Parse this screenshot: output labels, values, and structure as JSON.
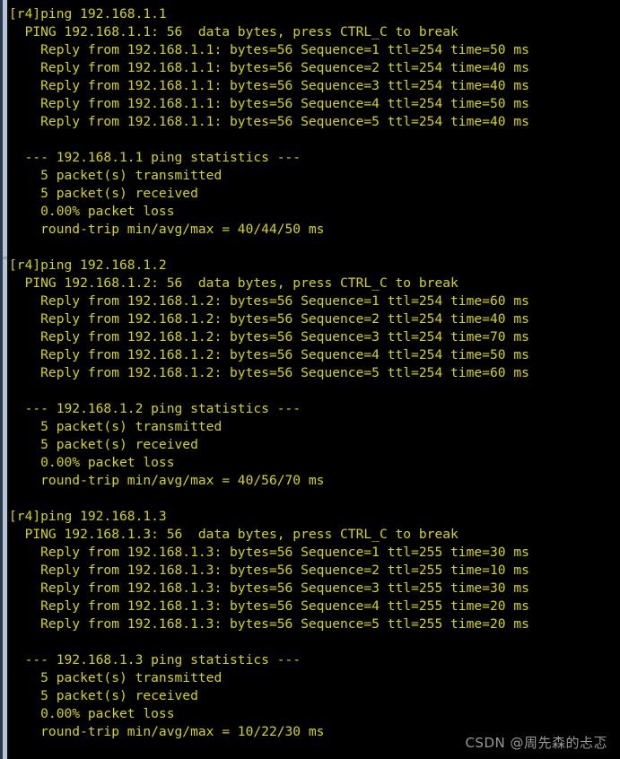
{
  "window": {
    "title": "Terminal - ping output",
    "background_color": "#000000",
    "text_color": "#d6d600",
    "chrome_edge_color": "#2b3b4d",
    "scrollbar_color": "#b6c5d8"
  },
  "watermark": {
    "text": "CSDN @周先森的忐忑",
    "color": "#9a9a9a"
  },
  "terminal": {
    "prompt": "[r4]",
    "lines": [
      "[r4]ping 192.168.1.1",
      "  PING 192.168.1.1: 56  data bytes, press CTRL_C to break",
      "    Reply from 192.168.1.1: bytes=56 Sequence=1 ttl=254 time=50 ms",
      "    Reply from 192.168.1.1: bytes=56 Sequence=2 ttl=254 time=40 ms",
      "    Reply from 192.168.1.1: bytes=56 Sequence=3 ttl=254 time=40 ms",
      "    Reply from 192.168.1.1: bytes=56 Sequence=4 ttl=254 time=50 ms",
      "    Reply from 192.168.1.1: bytes=56 Sequence=5 ttl=254 time=40 ms",
      "",
      "  --- 192.168.1.1 ping statistics ---",
      "    5 packet(s) transmitted",
      "    5 packet(s) received",
      "    0.00% packet loss",
      "    round-trip min/avg/max = 40/44/50 ms",
      "",
      "[r4]ping 192.168.1.2",
      "  PING 192.168.1.2: 56  data bytes, press CTRL_C to break",
      "    Reply from 192.168.1.2: bytes=56 Sequence=1 ttl=254 time=60 ms",
      "    Reply from 192.168.1.2: bytes=56 Sequence=2 ttl=254 time=40 ms",
      "    Reply from 192.168.1.2: bytes=56 Sequence=3 ttl=254 time=70 ms",
      "    Reply from 192.168.1.2: bytes=56 Sequence=4 ttl=254 time=50 ms",
      "    Reply from 192.168.1.2: bytes=56 Sequence=5 ttl=254 time=60 ms",
      "",
      "  --- 192.168.1.2 ping statistics ---",
      "    5 packet(s) transmitted",
      "    5 packet(s) received",
      "    0.00% packet loss",
      "    round-trip min/avg/max = 40/56/70 ms",
      "",
      "[r4]ping 192.168.1.3",
      "  PING 192.168.1.3: 56  data bytes, press CTRL_C to break",
      "    Reply from 192.168.1.3: bytes=56 Sequence=1 ttl=255 time=30 ms",
      "    Reply from 192.168.1.3: bytes=56 Sequence=2 ttl=255 time=10 ms",
      "    Reply from 192.168.1.3: bytes=56 Sequence=3 ttl=255 time=30 ms",
      "    Reply from 192.168.1.3: bytes=56 Sequence=4 ttl=255 time=20 ms",
      "    Reply from 192.168.1.3: bytes=56 Sequence=5 ttl=255 time=20 ms",
      "",
      "  --- 192.168.1.3 ping statistics ---",
      "    5 packet(s) transmitted",
      "    5 packet(s) received",
      "    0.00% packet loss",
      "    round-trip min/avg/max = 10/22/30 ms"
    ],
    "sessions": [
      {
        "command": "ping 192.168.1.1",
        "target": "192.168.1.1",
        "data_bytes": "56",
        "header": "PING 192.168.1.1: 56  data bytes, press CTRL_C to break",
        "replies": [
          {
            "sequence": "1",
            "bytes": "56",
            "ttl": "254",
            "time_ms": "50"
          },
          {
            "sequence": "2",
            "bytes": "56",
            "ttl": "254",
            "time_ms": "40"
          },
          {
            "sequence": "3",
            "bytes": "56",
            "ttl": "254",
            "time_ms": "40"
          },
          {
            "sequence": "4",
            "bytes": "56",
            "ttl": "254",
            "time_ms": "50"
          },
          {
            "sequence": "5",
            "bytes": "56",
            "ttl": "254",
            "time_ms": "40"
          }
        ],
        "statistics": {
          "header": "--- 192.168.1.1 ping statistics ---",
          "transmitted": "5 packet(s) transmitted",
          "received": "5 packet(s) received",
          "loss": "0.00% packet loss",
          "round_trip": "round-trip min/avg/max = 40/44/50 ms",
          "min_ms": "40",
          "avg_ms": "44",
          "max_ms": "50"
        }
      },
      {
        "command": "ping 192.168.1.2",
        "target": "192.168.1.2",
        "data_bytes": "56",
        "header": "PING 192.168.1.2: 56  data bytes, press CTRL_C to break",
        "replies": [
          {
            "sequence": "1",
            "bytes": "56",
            "ttl": "254",
            "time_ms": "60"
          },
          {
            "sequence": "2",
            "bytes": "56",
            "ttl": "254",
            "time_ms": "40"
          },
          {
            "sequence": "3",
            "bytes": "56",
            "ttl": "254",
            "time_ms": "70"
          },
          {
            "sequence": "4",
            "bytes": "56",
            "ttl": "254",
            "time_ms": "50"
          },
          {
            "sequence": "5",
            "bytes": "56",
            "ttl": "254",
            "time_ms": "60"
          }
        ],
        "statistics": {
          "header": "--- 192.168.1.2 ping statistics ---",
          "transmitted": "5 packet(s) transmitted",
          "received": "5 packet(s) received",
          "loss": "0.00% packet loss",
          "round_trip": "round-trip min/avg/max = 40/56/70 ms",
          "min_ms": "40",
          "avg_ms": "56",
          "max_ms": "70"
        }
      },
      {
        "command": "ping 192.168.1.3",
        "target": "192.168.1.3",
        "data_bytes": "56",
        "header": "PING 192.168.1.3: 56  data bytes, press CTRL_C to break",
        "replies": [
          {
            "sequence": "1",
            "bytes": "56",
            "ttl": "255",
            "time_ms": "30"
          },
          {
            "sequence": "2",
            "bytes": "56",
            "ttl": "255",
            "time_ms": "10"
          },
          {
            "sequence": "3",
            "bytes": "56",
            "ttl": "255",
            "time_ms": "30"
          },
          {
            "sequence": "4",
            "bytes": "56",
            "ttl": "255",
            "time_ms": "20"
          },
          {
            "sequence": "5",
            "bytes": "56",
            "ttl": "255",
            "time_ms": "20"
          }
        ],
        "statistics": {
          "header": "--- 192.168.1.3 ping statistics ---",
          "transmitted": "5 packet(s) transmitted",
          "received": "5 packet(s) received",
          "loss": "0.00% packet loss",
          "round_trip": "round-trip min/avg/max = 10/22/30 ms",
          "min_ms": "10",
          "avg_ms": "22",
          "max_ms": "30"
        }
      }
    ]
  }
}
